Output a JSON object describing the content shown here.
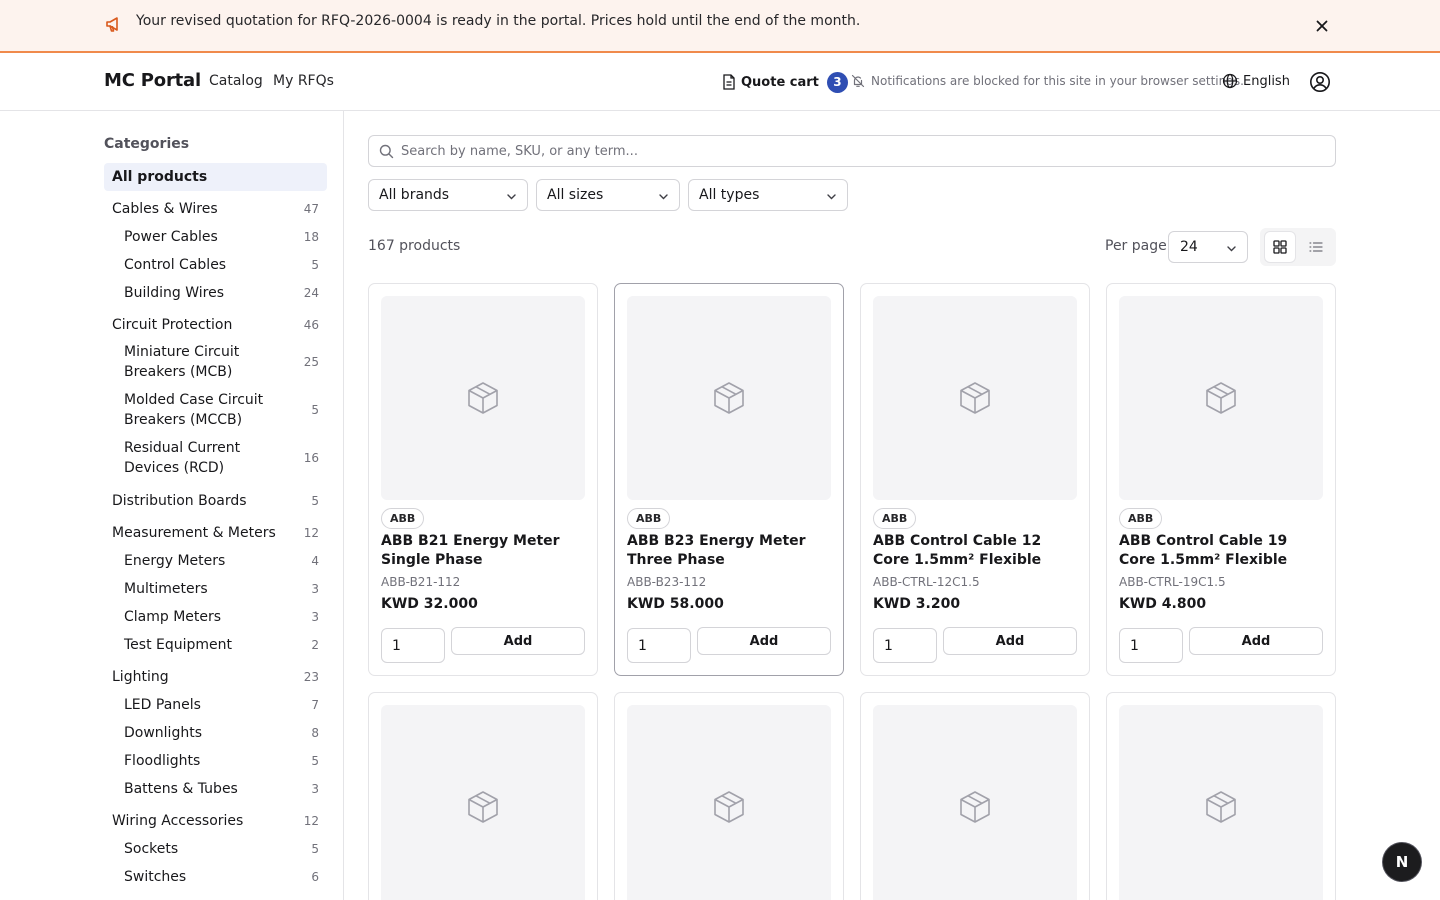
{
  "banner": {
    "message": "Your revised quotation for RFQ-2026-0004 is ready in the portal. Prices hold until the end of the month.",
    "icon": "megaphone-icon",
    "accent_color": "#f08a4b"
  },
  "header": {
    "logo": "MC Portal",
    "nav": [
      "Catalog",
      "My RFQs"
    ],
    "cart_label": "Quote cart",
    "cart_count": "3",
    "notification_text": "Notifications are blocked for this site in your browser settings.",
    "language": "English"
  },
  "sidebar": {
    "title": "Categories",
    "items": [
      {
        "label": "All products",
        "count": "",
        "level": 0,
        "active": true
      },
      {
        "label": "Cables & Wires",
        "count": "47",
        "level": 0
      },
      {
        "label": "Power Cables",
        "count": "18",
        "level": 1
      },
      {
        "label": "Control Cables",
        "count": "5",
        "level": 1
      },
      {
        "label": "Building Wires",
        "count": "24",
        "level": 1
      },
      {
        "label": "Circuit Protection",
        "count": "46",
        "level": 0
      },
      {
        "label": "Miniature Circuit Breakers (MCB)",
        "count": "25",
        "level": 1
      },
      {
        "label": "Molded Case Circuit Breakers (MCCB)",
        "count": "5",
        "level": 1
      },
      {
        "label": "Residual Current Devices (RCD)",
        "count": "16",
        "level": 1
      },
      {
        "label": "Distribution Boards",
        "count": "5",
        "level": 0
      },
      {
        "label": "Measurement & Meters",
        "count": "12",
        "level": 0
      },
      {
        "label": "Energy Meters",
        "count": "4",
        "level": 1
      },
      {
        "label": "Multimeters",
        "count": "3",
        "level": 1
      },
      {
        "label": "Clamp Meters",
        "count": "3",
        "level": 1
      },
      {
        "label": "Test Equipment",
        "count": "2",
        "level": 1
      },
      {
        "label": "Lighting",
        "count": "23",
        "level": 0
      },
      {
        "label": "LED Panels",
        "count": "7",
        "level": 1
      },
      {
        "label": "Downlights",
        "count": "8",
        "level": 1
      },
      {
        "label": "Floodlights",
        "count": "5",
        "level": 1
      },
      {
        "label": "Battens & Tubes",
        "count": "3",
        "level": 1
      },
      {
        "label": "Wiring Accessories",
        "count": "12",
        "level": 0
      },
      {
        "label": "Sockets",
        "count": "5",
        "level": 1
      },
      {
        "label": "Switches",
        "count": "6",
        "level": 1
      }
    ]
  },
  "search": {
    "placeholder": "Search by name, SKU, or any term..."
  },
  "filters": {
    "brand": "All brands",
    "size": "All sizes",
    "type": "All types"
  },
  "results": {
    "count_text": "167 products",
    "per_page_label": "Per page",
    "per_page_value": "24"
  },
  "products": [
    {
      "brand": "ABB",
      "name": "ABB B21 Energy Meter Single Phase",
      "sku": "ABB-B21-112",
      "price": "KWD 32.000",
      "qty": "1",
      "add_label": "Add"
    },
    {
      "brand": "ABB",
      "name": "ABB B23 Energy Meter Three Phase",
      "sku": "ABB-B23-112",
      "price": "KWD 58.000",
      "qty": "1",
      "add_label": "Add"
    },
    {
      "brand": "ABB",
      "name": "ABB Control Cable 12 Core 1.5mm² Flexible",
      "sku": "ABB-CTRL-12C1.5",
      "price": "KWD 3.200",
      "qty": "1",
      "add_label": "Add"
    },
    {
      "brand": "ABB",
      "name": "ABB Control Cable 19 Core 1.5mm² Flexible",
      "sku": "ABB-CTRL-19C1.5",
      "price": "KWD 4.800",
      "qty": "1",
      "add_label": "Add"
    }
  ],
  "fab": {
    "letter": "N"
  },
  "colors": {
    "accent": "#2f4eb3",
    "active_category_bg": "#eef1fa",
    "banner_bg": "#fdf3ee"
  }
}
